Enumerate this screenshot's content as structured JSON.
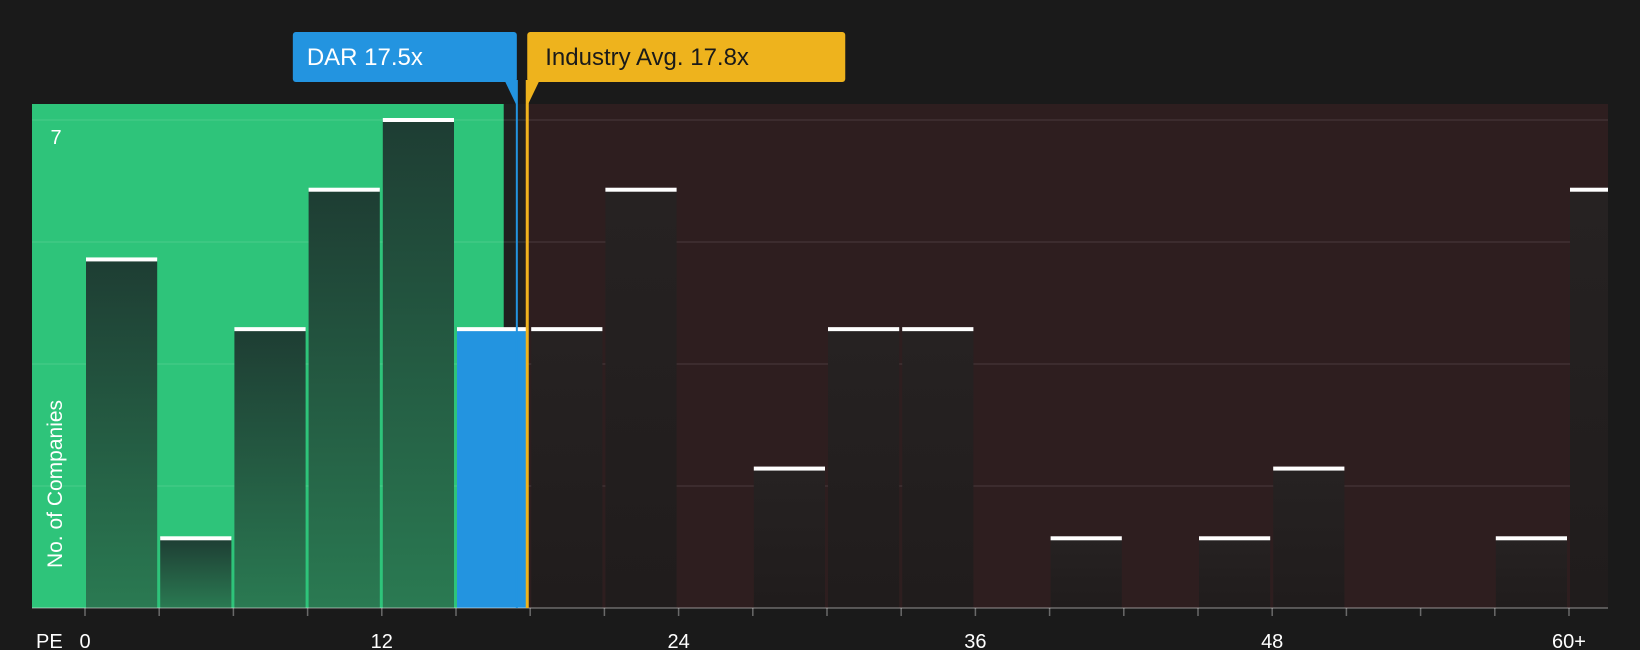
{
  "chart_data": {
    "type": "bar",
    "xlabel": "PE",
    "ylabel": "No. of Companies",
    "y_tick_label": "7",
    "ylim": [
      0,
      7
    ],
    "xlim": [
      0,
      61.5
    ],
    "bin_width": 3,
    "x_ticks": [
      {
        "value": 0,
        "label": "0"
      },
      {
        "value": 12,
        "label": "12"
      },
      {
        "value": 24,
        "label": "24"
      },
      {
        "value": 36,
        "label": "36"
      },
      {
        "value": 48,
        "label": "48"
      },
      {
        "value": 60,
        "label": "60+"
      }
    ],
    "bins": [
      {
        "start": 0,
        "count": 5
      },
      {
        "start": 3,
        "count": 1
      },
      {
        "start": 6,
        "count": 4
      },
      {
        "start": 9,
        "count": 6
      },
      {
        "start": 12,
        "count": 7
      },
      {
        "start": 15,
        "count": 4
      },
      {
        "start": 18,
        "count": 4
      },
      {
        "start": 21,
        "count": 6
      },
      {
        "start": 27,
        "count": 2
      },
      {
        "start": 30,
        "count": 4
      },
      {
        "start": 33,
        "count": 4
      },
      {
        "start": 39,
        "count": 1
      },
      {
        "start": 45,
        "count": 1
      },
      {
        "start": 48,
        "count": 2
      },
      {
        "start": 57,
        "count": 1
      },
      {
        "start": 60,
        "count": 6
      }
    ],
    "company": {
      "label": "DAR 17.5x",
      "value": 17.5
    },
    "industry": {
      "label": "Industry Avg. 17.8x",
      "value": 17.8
    },
    "colors": {
      "undervalued_zone": "#2ec47a",
      "overvalued_zone": "#2e1e1f",
      "bar_in_undervalued": "#22473a",
      "bar_in_overvalued": "#232020",
      "company_bar": "#2394e0",
      "company_label": "#2394e0",
      "industry_label": "#eeb31d",
      "bar_cap": "#ffffff"
    }
  }
}
